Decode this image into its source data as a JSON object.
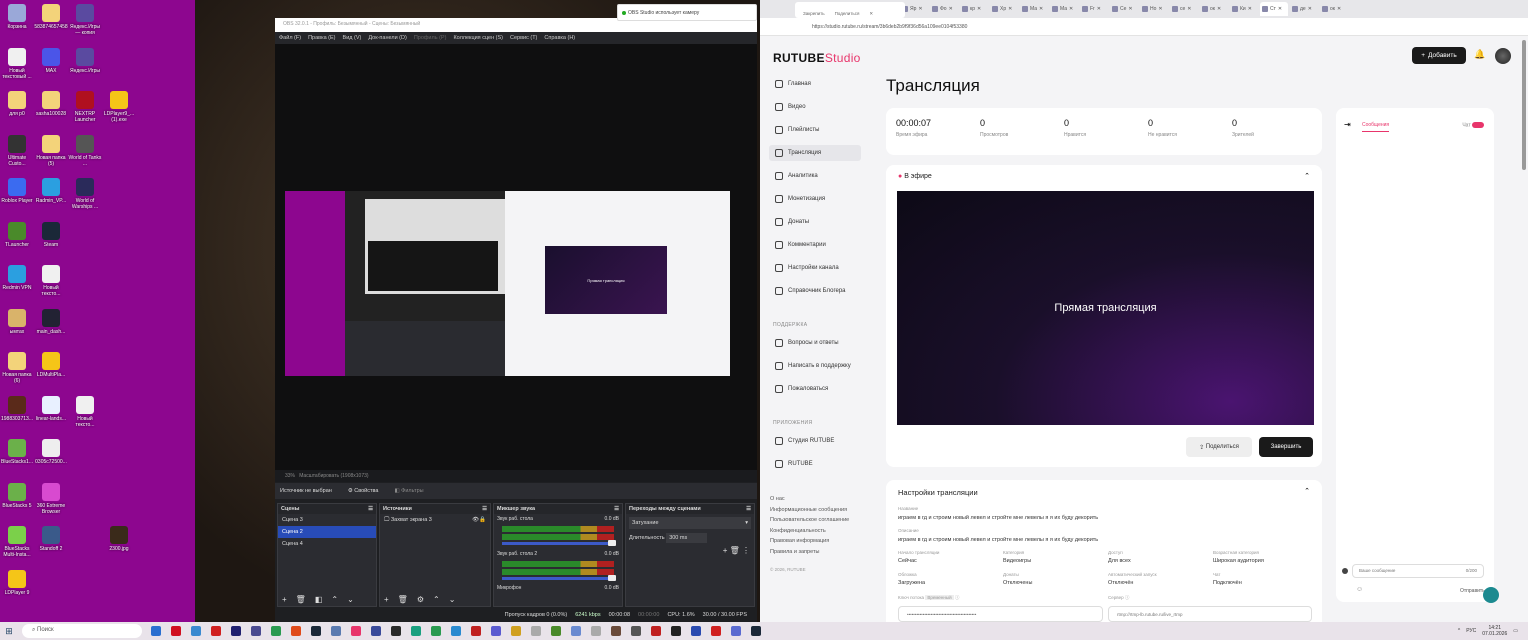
{
  "desktop": {
    "icons": [
      {
        "label": "Корзина",
        "color": "#9aa8d8"
      },
      {
        "label": "Новый текстовый ...",
        "color": "#f0f0f0"
      },
      {
        "label": "для р0",
        "color": "#f3d37a"
      },
      {
        "label": "Ultimate Custo...",
        "color": "#333"
      },
      {
        "label": "Roblox Player",
        "color": "#3b6bf0"
      },
      {
        "label": "TLauncher",
        "color": "#4a8a2a"
      },
      {
        "label": "Redmin VPN",
        "color": "#2b9fe0"
      },
      {
        "label": "ымтах",
        "color": "#d9b36a"
      },
      {
        "label": "Новая папка (6)",
        "color": "#f3d37a"
      },
      {
        "label": "1988303713...",
        "color": "#5a2a1a"
      },
      {
        "label": "BlueStacks1...",
        "color": "#6bb04a"
      },
      {
        "label": "BlueStacks 5",
        "color": "#6bb04a"
      },
      {
        "label": "BlueStacks Multi-Insta...",
        "color": "#7bd04a"
      },
      {
        "label": "LDPlayer 9",
        "color": "#f5c518"
      },
      {
        "label": "583874657458",
        "color": "#f3d37a"
      },
      {
        "label": "MAX",
        "color": "#4b55e8"
      },
      {
        "label": "sasha100028",
        "color": "#f3d37a"
      },
      {
        "label": "Новая папка (5)",
        "color": "#f3d37a"
      },
      {
        "label": "Radmin_VP...",
        "color": "#2b9fe0"
      },
      {
        "label": "Steam",
        "color": "#1b2838"
      },
      {
        "label": "Новый тексто...",
        "color": "#f0f0f0"
      },
      {
        "label": "main_dash...",
        "color": "#223"
      },
      {
        "label": "LDMultiPla...",
        "color": "#f5c518"
      },
      {
        "label": "linear-lands...",
        "color": "#e8f0ff"
      },
      {
        "label": "0305c72500...",
        "color": "#eee"
      },
      {
        "label": "360 Extreme Browser",
        "color": "#d84ad0"
      },
      {
        "label": "Standoff 2",
        "color": "#3a5a8a"
      },
      {
        "label": "Яндекс.Игры — копия",
        "color": "#5a4aa0"
      },
      {
        "label": "Яндекс.Игры",
        "color": "#5a4aa0"
      },
      {
        "label": "NEXTRP Launcher",
        "color": "#b01020"
      },
      {
        "label": "World of Tanks ...",
        "color": "#555"
      },
      {
        "label": "World of Warships ...",
        "color": "#2a2a5a"
      },
      {
        "label": "Новый тексто...",
        "color": "#f0f0f0"
      },
      {
        "label": "LDPlayer9_...(1).exe",
        "color": "#f5c518"
      },
      {
        "label": "2300.jpg",
        "color": "#3a2a1a"
      }
    ]
  },
  "obs": {
    "title": "OBS 32.0.1 - Профиль: Безымянный - Сцены: Безымянный",
    "menu": [
      "Файл (F)",
      "Правка (E)",
      "Вид (V)",
      "Док-панели (D)",
      "Профиль (P)",
      "Коллекция сцен (S)",
      "Сервис (T)",
      "Справка (H)"
    ],
    "zoom": "33%",
    "zoom_mode": "Масштабировать (1908x1073)",
    "preview_text": "Прямая трансляция",
    "no_source": "Источник не выбран",
    "properties": "Свойства",
    "filters": "Фильтры",
    "scenes": {
      "title": "Сцены",
      "items": [
        "Сцена 3",
        "Сцена 2",
        "Сцена 4"
      ],
      "selected": 1
    },
    "sources": {
      "title": "Источники",
      "items": [
        "Захват экрана 3"
      ]
    },
    "mixer": {
      "title": "Микшер звука",
      "channels": [
        {
          "name": "Звук раб. стола",
          "db": "0.0 dB"
        },
        {
          "name": "Звук раб. стола 2",
          "db": "0.0 dB"
        },
        {
          "name": "Микрофон",
          "db": "0.0 dB"
        }
      ]
    },
    "transitions": {
      "title": "Переходы между сценами",
      "type": "Затухание",
      "duration_label": "Длительность",
      "duration": "300 ms"
    },
    "status": {
      "dropped": "Пропуск кадров 0 (0.0%)",
      "bitrate": "6241 kbps",
      "live_time": "00:00:08",
      "rec_time": "00:00:00",
      "cpu": "CPU: 1.6%",
      "fps": "30.00 / 30.00 FPS"
    }
  },
  "notification": "OBS Studio использует камеру",
  "browser": {
    "tabs": [
      "Яр",
      "Фо",
      "кр",
      "Хр",
      "Ма",
      "Ма",
      "Fr",
      "Се",
      "Но",
      "се",
      "ок",
      "Ки",
      "Ст",
      "де",
      "ок"
    ],
    "active_tab": "Ст",
    "pin_popup": [
      "Закрепить",
      "Поделиться"
    ],
    "url": "https://studio.rutube.ru/stream/3b6deb2b9f9f36d56a109ee0104f53380"
  },
  "rutube": {
    "logo": "RUTUBE",
    "logo_suffix": "Studio",
    "add_button": "Добавить",
    "nav": [
      "Главная",
      "Видео",
      "Плейлисты",
      "Трансляция",
      "Аналитика",
      "Монетизация",
      "Донаты",
      "Комментарии",
      "Настройки канала",
      "Справочник Блогера"
    ],
    "active_nav": 3,
    "support_title": "ПОДДЕРЖКА",
    "support": [
      "Вопросы и ответы",
      "Написать в поддержку",
      "Пожаловаться"
    ],
    "apps_title": "ПРИЛОЖЕНИЯ",
    "apps": [
      "Студия RUTUBE",
      "RUTUBE"
    ],
    "footer": [
      "О нас",
      "Информационные сообщения",
      "Пользовательское соглашение",
      "Конфиденциальность",
      "Правовая информация",
      "Правила и запреты"
    ],
    "copyright": "© 2026, RUTUBE",
    "title": "Трансляция",
    "stats": [
      {
        "value": "00:00:07",
        "label": "Время эфира"
      },
      {
        "value": "0",
        "label": "Просмотров"
      },
      {
        "value": "0",
        "label": "Нравится"
      },
      {
        "value": "0",
        "label": "Не нравится"
      },
      {
        "value": "0",
        "label": "Зрителей"
      }
    ],
    "live_label": "В эфире",
    "video_text": "Прямая трансляция",
    "share": "Поделиться",
    "finish": "Завершить",
    "settings": {
      "title": "Настройки трансляции",
      "name_label": "Название",
      "name": "играем в гд и строим новый левел и стройте мне левелы я я их буду декорить",
      "desc_label": "Описание",
      "desc": "играем в гд и строим новый левел и стройте мне левелы я я их буду декорить",
      "fields": [
        {
          "label": "Начало трансляции",
          "value": "Сейчас"
        },
        {
          "label": "Категория",
          "value": "Видеоигры"
        },
        {
          "label": "Доступ",
          "value": "Для всех"
        },
        {
          "label": "Возрастная категория",
          "value": "Широкая аудитория"
        },
        {
          "label": "Обложка",
          "value": "Загружена"
        },
        {
          "label": "Донаты",
          "value": "Отключены"
        },
        {
          "label": "Автоматический запуск",
          "value": "Отключён"
        },
        {
          "label": "Чат",
          "value": "Подключён"
        }
      ],
      "key_label": "Ключ потока",
      "key_badge": "Временный",
      "key_value": "••••••••••••••••••••••••••••••••••••••••••••",
      "server_label": "Сервер",
      "server_value": "rtmp://rtmp-lb.rutube.ru/live_rtmp"
    },
    "chat": {
      "tab": "Сообщения",
      "toggle_label": "Чат",
      "placeholder": "Ваше сообщение",
      "counter": "0/200",
      "send": "Отправить"
    }
  },
  "taskbar": {
    "search": "Поиск",
    "lang": "РУС",
    "time": "14:21",
    "date": "07.01.2026",
    "apps": [
      "#2a6fd0",
      "#d01020",
      "#3a8ad0",
      "#d02020",
      "#202070",
      "#4a4a90",
      "#2a9a50",
      "#e04a1a",
      "#1b2838",
      "#5a7ab0",
      "#e8356b",
      "#3a4a9a",
      "#2a2a2a",
      "#1aa080",
      "#2a9a50",
      "#2a8ad0",
      "#c02020",
      "#5a5ad0",
      "#d0a020",
      "#aaaaaa",
      "#4a8a2a",
      "#6a8ad0",
      "#aaaaaa",
      "#6a4a3a",
      "#555555",
      "#c02020",
      "#222222",
      "#2a4ab0",
      "#d02020",
      "#5a6ad0",
      "#1b2838"
    ]
  }
}
